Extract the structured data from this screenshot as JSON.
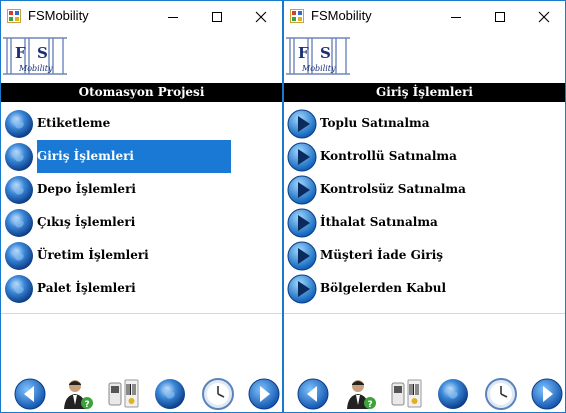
{
  "windows": [
    {
      "title": "FSMobility",
      "logo": {
        "letters": "F S",
        "subtitle": "Mobility"
      },
      "header": "Otomasyon Projesi",
      "icon_style": "globe",
      "items": [
        {
          "label": "Etiketleme",
          "selected": false
        },
        {
          "label": "Giriş İşlemleri",
          "selected": true
        },
        {
          "label": "Depo İşlemleri",
          "selected": false
        },
        {
          "label": "Çıkış İşlemleri",
          "selected": false
        },
        {
          "label": "Üretim İşlemleri",
          "selected": false
        },
        {
          "label": "Palet İşlemleri",
          "selected": false
        }
      ]
    },
    {
      "title": "FSMobility",
      "logo": {
        "letters": "F S",
        "subtitle": "Mobility"
      },
      "header": "Giriş İşlemleri",
      "icon_style": "play-arrow",
      "items": [
        {
          "label": "Toplu Satınalma",
          "selected": false
        },
        {
          "label": "Kontrollü Satınalma",
          "selected": false
        },
        {
          "label": "Kontrolsüz Satınalma",
          "selected": false
        },
        {
          "label": "İthalat Satınalma",
          "selected": false
        },
        {
          "label": "Müşteri İade Giriş",
          "selected": false
        },
        {
          "label": "Bölgelerden Kabul",
          "selected": false
        }
      ]
    }
  ],
  "toolbar_icons": [
    "back-arrow-icon",
    "user-help-icon",
    "barcode-scanner-icon",
    "globe-icon",
    "clock-icon",
    "forward-arrow-icon"
  ],
  "colors": {
    "accent": "#1a79d4",
    "header_bg": "#000000",
    "window_border": "#1979ca"
  }
}
